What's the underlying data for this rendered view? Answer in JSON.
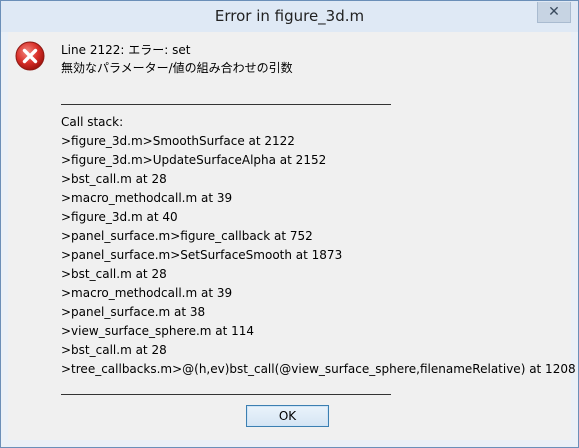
{
  "window": {
    "title": "Error in figure_3d.m",
    "close_label": "✕"
  },
  "message": {
    "line1": "Line 2122: エラー: set",
    "line2": "無効なパラメーター/値の組み合わせの引数"
  },
  "call_stack": {
    "heading": "Call stack:",
    "entries": [
      ">figure_3d.m>SmoothSurface at 2122",
      ">figure_3d.m>UpdateSurfaceAlpha at 2152",
      ">bst_call.m at 28",
      ">macro_methodcall.m at 39",
      ">figure_3d.m at 40",
      ">panel_surface.m>figure_callback at 752",
      ">panel_surface.m>SetSurfaceSmooth at 1873",
      ">bst_call.m at 28",
      ">macro_methodcall.m at 39",
      ">panel_surface.m at 38",
      ">view_surface_sphere.m at 114",
      ">bst_call.m at 28",
      ">tree_callbacks.m>@(h,ev)bst_call(@view_surface_sphere,filenameRelative) at 1208"
    ]
  },
  "buttons": {
    "ok_label": "OK"
  },
  "colors": {
    "error_icon": "#d9302a",
    "button_border": "#3c7fb1"
  },
  "icons": {
    "error": "error-x-icon",
    "close": "close-icon"
  }
}
